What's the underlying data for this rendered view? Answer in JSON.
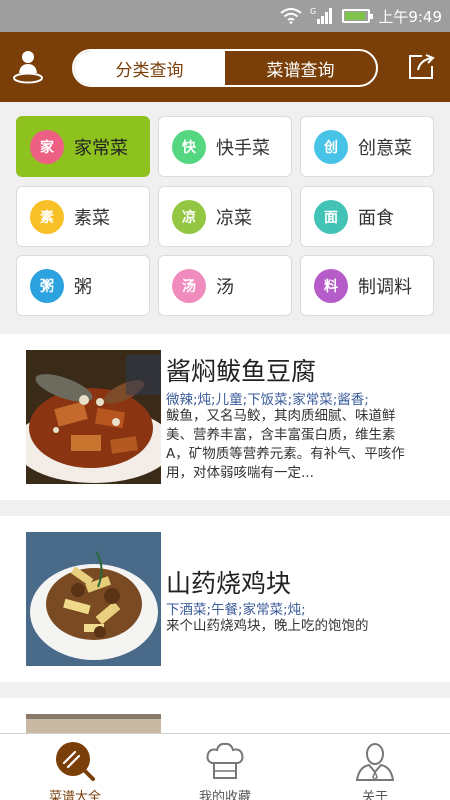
{
  "status_bar": {
    "time": "上午9:49",
    "network": "G"
  },
  "header": {
    "tabs": [
      {
        "label": "分类查询",
        "active": true
      },
      {
        "label": "菜谱查询",
        "active": false
      }
    ]
  },
  "categories": [
    {
      "label": "家常菜",
      "icon_text": "家",
      "color": "#ee5f84",
      "active": true
    },
    {
      "label": "快手菜",
      "icon_text": "快",
      "color": "#55d681"
    },
    {
      "label": "创意菜",
      "icon_text": "创",
      "color": "#47c3e8"
    },
    {
      "label": "素菜",
      "icon_text": "素",
      "color": "#f6c026"
    },
    {
      "label": "凉菜",
      "icon_text": "凉",
      "color": "#93c743"
    },
    {
      "label": "面食",
      "icon_text": "面",
      "color": "#42c3b5"
    },
    {
      "label": "粥",
      "icon_text": "粥",
      "color": "#2ca2df"
    },
    {
      "label": "汤",
      "icon_text": "汤",
      "color": "#f08cbd"
    },
    {
      "label": "制调料",
      "icon_text": "料",
      "color": "#b65cc8"
    }
  ],
  "recipes": [
    {
      "title": "酱焖鲅鱼豆腐",
      "tags": "微辣;炖;儿童;下饭菜;家常菜;酱香;",
      "desc": "鲅鱼，又名马鲛，其肉质细腻、味道鲜美、营养丰富，含丰富蛋白质，维生素A，矿物质等营养元素。有补气、平咳作用，对体弱咳喘有一定..."
    },
    {
      "title": "山药烧鸡块",
      "tags": "下酒菜;午餐;家常菜;炖;",
      "desc": "来个山药烧鸡块，晚上吃的饱饱的"
    }
  ],
  "bottom_nav": [
    {
      "label": "菜谱大全",
      "icon": "spatula-icon",
      "active": true
    },
    {
      "label": "我的收藏",
      "icon": "chef-hat-icon",
      "active": false
    },
    {
      "label": "关于",
      "icon": "person-icon",
      "active": false
    }
  ],
  "colors": {
    "brand": "#7a3f08",
    "active_category": "#8ec21f",
    "tag_text": "#3a5a9a"
  }
}
